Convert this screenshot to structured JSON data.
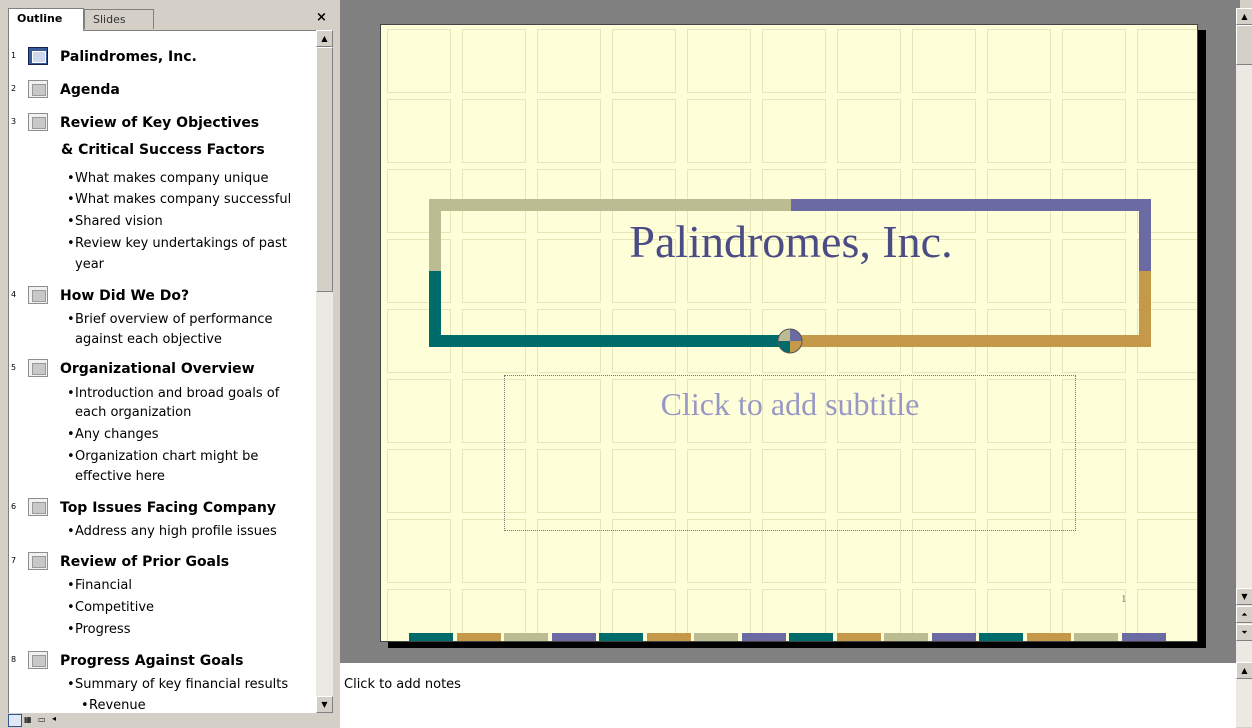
{
  "tabs": {
    "outline": "Outline",
    "slides": "Slides",
    "close": "×"
  },
  "outline": {
    "slides": [
      {
        "num": "1",
        "title": "Palindromes, Inc."
      },
      {
        "num": "2",
        "title": "Agenda"
      },
      {
        "num": "3",
        "title": "Review of Key Objectives",
        "title2": "& Critical Success Factors",
        "bullets": [
          "What makes company unique",
          "What makes company successful",
          "Shared vision",
          "Review key undertakings of past",
          "year"
        ]
      },
      {
        "num": "4",
        "title": "How Did We Do?",
        "bullets": [
          "Brief overview of performance",
          "against each objective"
        ]
      },
      {
        "num": "5",
        "title": "Organizational Overview",
        "bullets": [
          "Introduction and broad goals of",
          "each organization",
          "Any changes",
          "Organization chart might be",
          "effective here"
        ]
      },
      {
        "num": "6",
        "title": "Top Issues Facing Company",
        "bullets": [
          "Address any high profile issues"
        ]
      },
      {
        "num": "7",
        "title": "Review of Prior Goals",
        "bullets": [
          "Financial",
          "Competitive",
          "Progress"
        ]
      },
      {
        "num": "8",
        "title": "Progress Against Goals",
        "bullets": [
          "Summary of key financial results",
          "Revenue"
        ]
      }
    ]
  },
  "slide": {
    "title": "Palindromes, Inc.",
    "subtitle_placeholder": "Click to add subtitle",
    "number": "1",
    "colors": {
      "teal": "#006b6b",
      "gold": "#c49a4a",
      "sage": "#bcbc93",
      "purple": "#6b6aa3"
    }
  },
  "notes": {
    "placeholder": "Click to add notes"
  }
}
